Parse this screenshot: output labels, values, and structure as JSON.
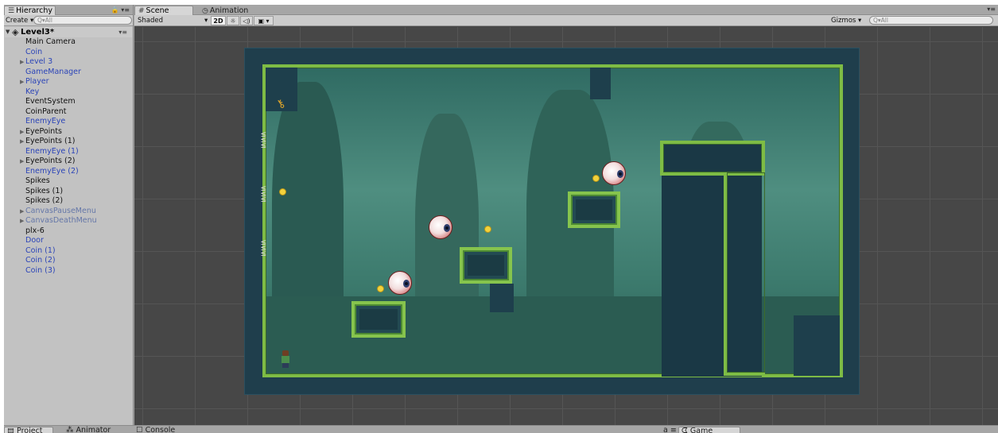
{
  "hierarchy": {
    "tab_label": "Hierarchy",
    "create_label": "Create",
    "search_placeholder": "Q▾All",
    "scene_name": "Level3*",
    "items": [
      {
        "label": "Main Camera",
        "color": "black",
        "arrow": false
      },
      {
        "label": "Coin",
        "color": "blue",
        "arrow": false
      },
      {
        "label": "Level 3",
        "color": "blue",
        "arrow": true
      },
      {
        "label": "GameManager",
        "color": "blue",
        "arrow": false
      },
      {
        "label": "Player",
        "color": "blue",
        "arrow": true
      },
      {
        "label": "Key",
        "color": "blue",
        "arrow": false
      },
      {
        "label": "EventSystem",
        "color": "black",
        "arrow": false
      },
      {
        "label": "CoinParent",
        "color": "black",
        "arrow": false
      },
      {
        "label": "EnemyEye",
        "color": "blue",
        "arrow": false
      },
      {
        "label": "EyePoints",
        "color": "black",
        "arrow": true
      },
      {
        "label": "EyePoints (1)",
        "color": "black",
        "arrow": true
      },
      {
        "label": "EnemyEye (1)",
        "color": "blue",
        "arrow": false
      },
      {
        "label": "EyePoints (2)",
        "color": "black",
        "arrow": true
      },
      {
        "label": "EnemyEye (2)",
        "color": "blue",
        "arrow": false
      },
      {
        "label": "Spikes",
        "color": "black",
        "arrow": false
      },
      {
        "label": "Spikes (1)",
        "color": "black",
        "arrow": false
      },
      {
        "label": "Spikes (2)",
        "color": "black",
        "arrow": false
      },
      {
        "label": "CanvasPauseMenu",
        "color": "faded",
        "arrow": true
      },
      {
        "label": "CanvasDeathMenu",
        "color": "faded",
        "arrow": true
      },
      {
        "label": "plx-6",
        "color": "black",
        "arrow": false
      },
      {
        "label": "Door",
        "color": "blue",
        "arrow": false
      },
      {
        "label": "Coin (1)",
        "color": "blue",
        "arrow": false
      },
      {
        "label": "Coin (2)",
        "color": "blue",
        "arrow": false
      },
      {
        "label": "Coin (3)",
        "color": "blue",
        "arrow": false
      }
    ]
  },
  "scene": {
    "tab_scene": "Scene",
    "tab_animation": "Animation",
    "shading_mode": "Shaded",
    "mode_2d": "2D",
    "gizmos_label": "Gizmos",
    "search_placeholder": "Q▾All"
  },
  "bottom": {
    "tab_project": "Project",
    "tab_animator": "Animator",
    "tab_console": "Console",
    "tab_game": "Game"
  },
  "icons": {
    "hierarchy": "list-icon",
    "scene": "grid-icon",
    "animation": "clock-icon",
    "lock": "lock-icon",
    "panel_menu": "panel-menu-icon",
    "unity_scene": "unity-logo-icon",
    "lighting": "sun-icon",
    "audio": "speaker-icon",
    "effects": "image-icon",
    "project": "folder-icon",
    "animator": "animator-icon",
    "console": "console-icon",
    "game": "pacman-icon"
  },
  "colors": {
    "panel_bg": "#c2c2c2",
    "scene_bg": "#474747",
    "prefab_blue": "#2b44b8",
    "grass_green": "#86c44d"
  }
}
